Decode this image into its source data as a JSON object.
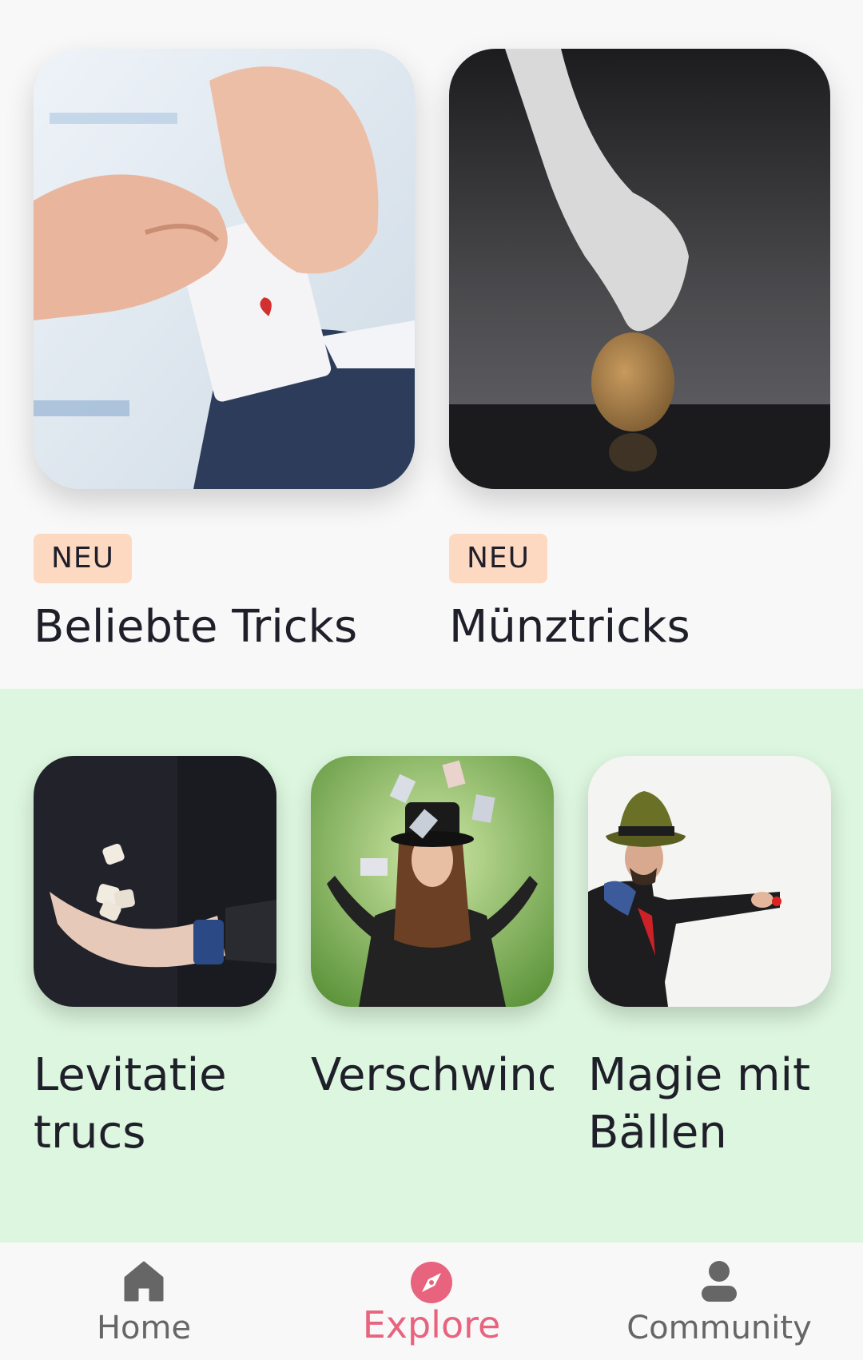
{
  "featured": [
    {
      "badge": "NEU",
      "title": "Beliebte Tricks",
      "image": "card-in-sleeve-photo"
    },
    {
      "badge": "NEU",
      "title": "Münztricks",
      "image": "hand-holding-coin-photo"
    }
  ],
  "categories": [
    {
      "title": "Levitatie trucs",
      "image": "floating-dice-photo"
    },
    {
      "title": "Verschwinden",
      "image": "woman-with-flying-cards-photo"
    },
    {
      "title": "Magie mit Bällen",
      "image": "man-with-ball-photo"
    }
  ],
  "nav": {
    "items": [
      {
        "label": "Home",
        "icon": "home-icon"
      },
      {
        "label": "Explore",
        "icon": "compass-icon",
        "active": true
      },
      {
        "label": "Community",
        "icon": "person-icon"
      }
    ]
  },
  "colors": {
    "accent": "#e8637e",
    "badge_bg": "#fdd9c1",
    "green_section": "#ddf6df",
    "text": "#1f1f2a"
  }
}
